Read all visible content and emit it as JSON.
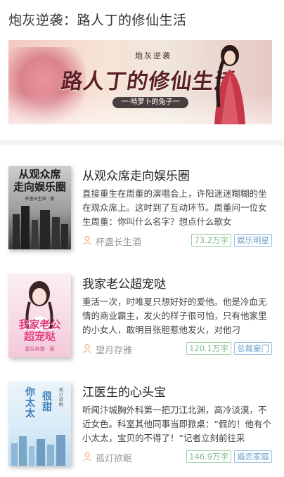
{
  "header": {
    "title": "炮灰逆袭：路人丁的修仙生活"
  },
  "banner": {
    "small_text": "炮灰逆袭",
    "big_text": "路人丁的修仙生活",
    "author_text": "一·啃萝卜的兔子一"
  },
  "books": [
    {
      "title": "从观众席走向娱乐圈",
      "description": "直接重生在周董的演唱会上，许阳迷迷糊糊的坐在观众席上。这时到了互动环节。周董问一位女生周董：你叫什么名字？想点什么歌女",
      "author": "杯盏长生酒",
      "word_count": "73.2万字",
      "genre": "娱乐明星",
      "cover": {
        "title_line1": "从观众席",
        "title_line2": "走向娱乐圈",
        "author_line": "杯盏长生酒 · 著"
      }
    },
    {
      "title": "我家老公超宠哒",
      "description": "重活一次，时唯夏只想好好的爱他。他是冷血无情的商业霸主，发火的样子很可怕，只有他家里的小女人，敢明目张胆惹他发火，对他刁",
      "author": "望月存雅",
      "word_count": "120.1万字",
      "genre": "总裁豪门",
      "cover": {
        "title_line1": "我家老公",
        "title_line2": "超宠哒",
        "author_line": "望月存雅 · 著"
      }
    },
    {
      "title": "江医生的心头宝",
      "description": "听闻汴城胸外科第一把刀江北渊，高冷淡漠，不近女色。科室其他同事当即掀桌：“假的！他有个小太太，宝贝的不得了！”记者立刻前往采",
      "author": "孤灯欲眠",
      "word_count": "146.9万字",
      "genre": "婚恋家庭",
      "cover": {
        "title_a": "你太太",
        "title_b": "很甜",
        "author_line": "孤灯欲眠"
      }
    }
  ],
  "colors": {
    "tag_green": "#7dbb88",
    "tag_blue": "#6e9fc9",
    "divider": "#f4f4f4"
  },
  "icons": {
    "author": "person-outline-icon"
  }
}
